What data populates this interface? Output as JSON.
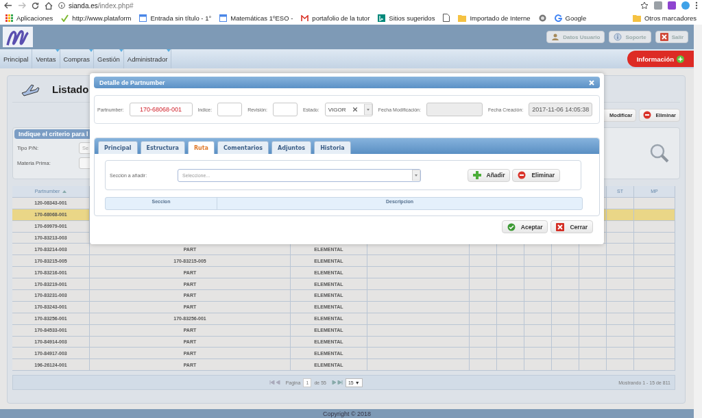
{
  "browser": {
    "url_host": "sianda.es",
    "url_path": "/index.php#",
    "bookmarks": [
      {
        "label": "Aplicaciones",
        "kind": "apps"
      },
      {
        "label": "http://www.plataform",
        "kind": "check"
      },
      {
        "label": "Entrada sin título - 1°",
        "kind": "sheet"
      },
      {
        "label": "Matemáticas 1ºESO -",
        "kind": "sheet"
      },
      {
        "label": "portafolio de la tutor",
        "kind": "mail"
      },
      {
        "label": "Sitios sugeridos",
        "kind": "bing"
      },
      {
        "kind": "page"
      },
      {
        "label": "Importado de Interne",
        "kind": "folder"
      },
      {
        "kind": "globe"
      },
      {
        "label": "Google",
        "kind": "google"
      }
    ],
    "other_bookmarks": "Otros marcadores"
  },
  "header": {
    "buttons": [
      {
        "label": "Datos Usuario",
        "kind": "user"
      },
      {
        "label": "Soporte",
        "kind": "support"
      },
      {
        "label": "Salir",
        "kind": "exit"
      }
    ]
  },
  "nav": {
    "items": [
      {
        "label": "Principal",
        "dropdown": false
      },
      {
        "label": "Ventas",
        "dropdown": true
      },
      {
        "label": "Compras",
        "dropdown": true
      },
      {
        "label": "Gestión",
        "dropdown": true
      },
      {
        "label": "Administrador",
        "dropdown": true
      }
    ],
    "info_button": "Información"
  },
  "page": {
    "title": "Listado",
    "actions": [
      {
        "label": "Modificar",
        "kind": "edit"
      },
      {
        "label": "Eliminar",
        "kind": "delete"
      }
    ],
    "filter": {
      "title": "Indique el criterio para l",
      "fields": [
        {
          "label": "Tipo P/N:",
          "placeholder": "Se"
        },
        {
          "label": "Materia Prima:"
        }
      ]
    }
  },
  "table": {
    "columns": [
      {
        "label": "Partnumber",
        "sorted": true
      },
      {},
      {},
      {},
      {},
      {},
      {},
      {},
      {},
      {
        "label": "ST"
      },
      {
        "label": "MP"
      }
    ],
    "rows": [
      {
        "cells": [
          "120-08343-001"
        ],
        "selected": false
      },
      {
        "cells": [
          "170-68068-001"
        ],
        "selected": true
      },
      {
        "cells": [
          "170-69979-001"
        ],
        "selected": false
      },
      {
        "cells": [
          "170-83213-003"
        ],
        "selected": false
      },
      {
        "cells": [
          "170-83214-003",
          "PART",
          "ELEMENTAL"
        ],
        "selected": false
      },
      {
        "cells": [
          "170-83215-005",
          "170-83215-005",
          "ELEMENTAL"
        ],
        "selected": false
      },
      {
        "cells": [
          "170-83216-001",
          "PART",
          "ELEMENTAL"
        ],
        "selected": false
      },
      {
        "cells": [
          "170-83219-001",
          "PART",
          "ELEMENTAL"
        ],
        "selected": false
      },
      {
        "cells": [
          "170-83231-003",
          "PART",
          "ELEMENTAL"
        ],
        "selected": false
      },
      {
        "cells": [
          "170-83243-001",
          "PART",
          "ELEMENTAL"
        ],
        "selected": false
      },
      {
        "cells": [
          "170-83256-001",
          "170-83256-001",
          "ELEMENTAL"
        ],
        "selected": false
      },
      {
        "cells": [
          "170-84533-001",
          "PART",
          "ELEMENTAL"
        ],
        "selected": false
      },
      {
        "cells": [
          "170-84914-003",
          "PART",
          "ELEMENTAL"
        ],
        "selected": false
      },
      {
        "cells": [
          "170-84917-003",
          "PART",
          "ELEMENTAL"
        ],
        "selected": false
      },
      {
        "cells": [
          "196-26124-001",
          "PART",
          "ELEMENTAL"
        ],
        "selected": false
      }
    ],
    "pager": {
      "page_label": "Pagina",
      "page": "1",
      "of": "de 55",
      "page_size": "15 ▼",
      "summary": "Mostrando 1 - 15 de 811"
    }
  },
  "footer": "Copyright © 2018",
  "dialog": {
    "title": "Detalle de Partnumber",
    "fields": [
      {
        "label": "Partnumber:",
        "value": "170-68068-001",
        "kind": "text"
      },
      {
        "label": "Indice:",
        "kind": "text"
      },
      {
        "label": "Revisión:",
        "kind": "text"
      },
      {
        "label": "Estado:",
        "value": "VIGOR",
        "kind": "select"
      },
      {
        "label": "Fecha Modificación:",
        "kind": "readonly"
      },
      {
        "label": "Fecha Creación:",
        "value": "2017-11-06 14:05:38",
        "kind": "readonly"
      }
    ],
    "tabs": [
      {
        "label": "Principal",
        "selected": false
      },
      {
        "label": "Estructura",
        "selected": false
      },
      {
        "label": "Ruta",
        "selected": true
      },
      {
        "label": "Comentarios",
        "selected": false
      },
      {
        "label": "Adjuntos",
        "selected": false
      },
      {
        "label": "Historia",
        "selected": false
      }
    ],
    "section": {
      "label": "Sección a añadir:",
      "placeholder": "Seleccione...",
      "buttons": [
        {
          "label": "Añadir",
          "kind": "add"
        },
        {
          "label": "Eliminar",
          "kind": "delete"
        }
      ]
    },
    "columns": [
      "Seccion",
      "Descripcion"
    ],
    "buttons": [
      {
        "label": "Aceptar",
        "kind": "ok"
      },
      {
        "label": "Cerrar",
        "kind": "close"
      }
    ]
  }
}
